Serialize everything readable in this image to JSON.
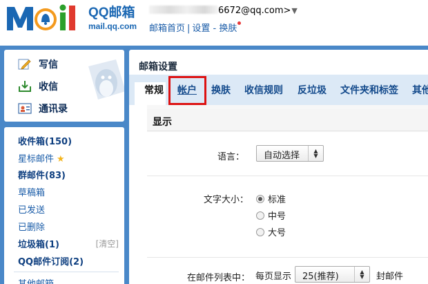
{
  "header": {
    "logo_brand": "QQ邮箱",
    "logo_url": "mail.qq.com",
    "user_email_suffix": "6672@qq.com>",
    "user_menu_caret": "▼",
    "links": [
      "邮箱首页",
      "设置",
      "换肤"
    ],
    "link_separator": "|",
    "skin_badge_color": "#e83838"
  },
  "sidebar": {
    "actions": [
      {
        "label": "写信",
        "icon": "pencil-icon"
      },
      {
        "label": "收信",
        "icon": "inbox-download-icon"
      },
      {
        "label": "通讯录",
        "icon": "contacts-icon"
      }
    ],
    "folders": [
      {
        "label": "收件箱(150)",
        "bold": true
      },
      {
        "label": "星标邮件",
        "bold": false,
        "icon": "star-icon"
      },
      {
        "label": "群邮件(83)",
        "bold": true
      },
      {
        "label": "草稿箱",
        "bold": false
      },
      {
        "label": "已发送",
        "bold": false
      },
      {
        "label": "已删除",
        "bold": false
      },
      {
        "label": "垃圾箱(1)",
        "bold": true
      },
      {
        "label": "QQ邮件订阅(2)",
        "bold": true
      },
      {
        "label": "其他邮箱",
        "bold": false
      }
    ],
    "clear_label": "[清空]"
  },
  "main": {
    "title": "邮箱设置",
    "tabs": [
      "常规",
      "帐户",
      "换肤",
      "收信规则",
      "反垃圾",
      "文件夹和标签",
      "其他"
    ],
    "active_tab": "常规",
    "highlighted_tab": "帐户",
    "highlight_color": "#dd1111",
    "section_title": "显示",
    "language": {
      "label": "语言：",
      "value": "自动选择"
    },
    "font_size": {
      "label": "文字大小：",
      "options": [
        "标准",
        "中号",
        "大号"
      ],
      "selected": "标准"
    },
    "list_setting": {
      "label": "在邮件列表中：",
      "prefix": "每页显示",
      "value": "25(推荐)",
      "suffix": "封邮件"
    }
  },
  "colors": {
    "frame_blue": "#4a88c8",
    "tab_bar": "#dce9f6",
    "link_blue": "#1a5ca8",
    "brand_blue": "#1a67b3"
  }
}
